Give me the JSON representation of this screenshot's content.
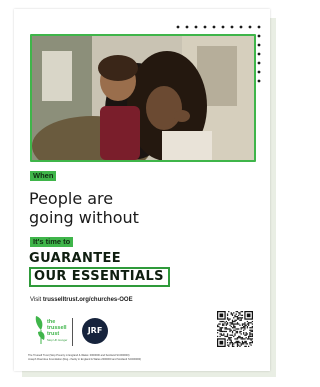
{
  "poster": {
    "when_tag": "When",
    "headline_line1": "People are",
    "headline_line2": "going without",
    "time_tag": "It's time to",
    "guarantee": "GUARANTEE",
    "essentials": "OUR ESSENTIALS",
    "visit_prefix": "Visit ",
    "visit_url": "trusselltrust.org/churches-OOE",
    "trussell_logo_text": [
      "the",
      "trussell",
      "trust"
    ],
    "trussell_tagline": "Stop UK Hunger",
    "jrf_logo_text": "JRF",
    "footnote_line1": "The Trussell Trust (Stop Poverty in England & Wales: 0000000 and Scotland SC000000)",
    "footnote_line2": "Joseph Rowntree Foundation (Reg. charity in England & Wales 2000000 and Scotland SC000000)"
  },
  "colors": {
    "accent_green": "#3fb54a",
    "border_green": "#2f9a3a",
    "jrf_navy": "#16233c",
    "text_dark": "#1b1b1b"
  },
  "icons": {
    "trussell_logo": "trussell-trust-leaf-logo",
    "jrf_logo": "jrf-circle-logo",
    "qr": "qr-code",
    "dots": "decorative-dot-pattern"
  }
}
